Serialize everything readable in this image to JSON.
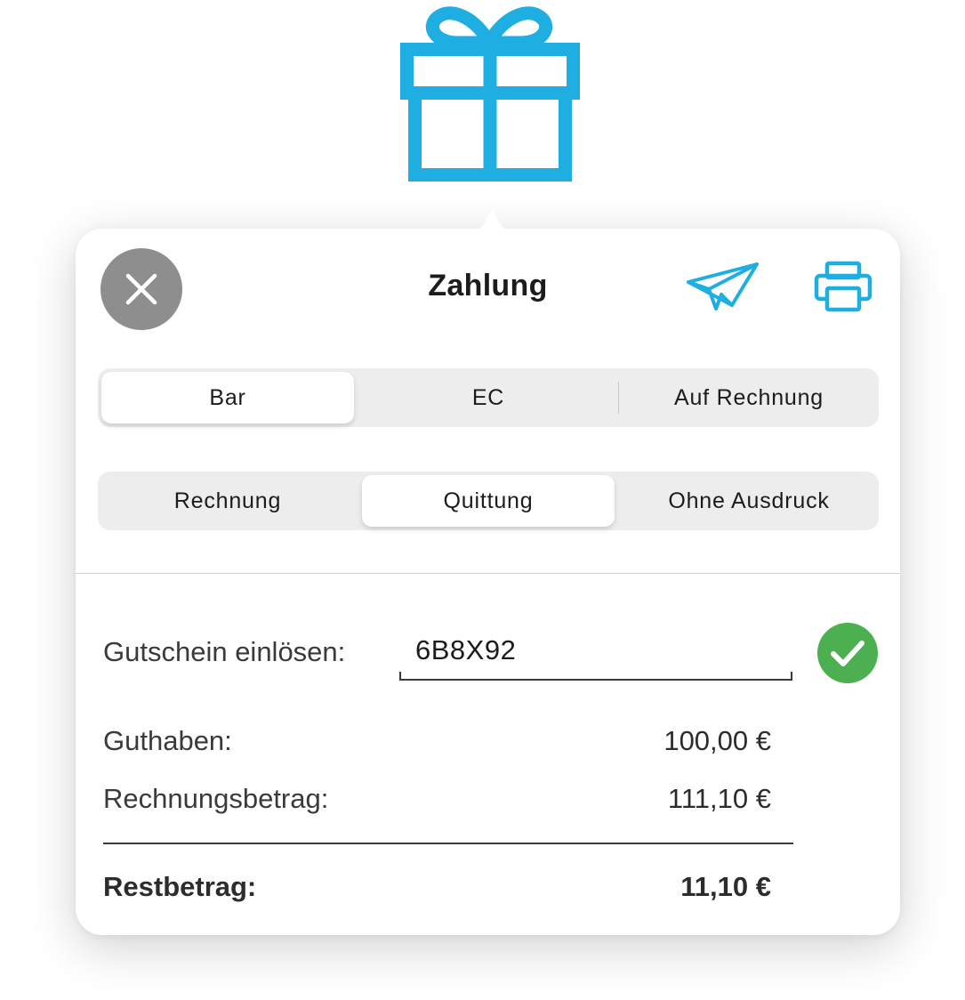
{
  "header": {
    "title": "Zahlung"
  },
  "icons": {
    "gift": "gift-icon",
    "close": "close-icon",
    "send": "paper-plane-icon",
    "print": "printer-icon",
    "confirm": "checkmark-circle-icon"
  },
  "colors": {
    "accent": "#1eaee2",
    "confirm_green": "#4caf50",
    "close_gray": "#8e8e8e"
  },
  "payment_method": {
    "options": [
      "Bar",
      "EC",
      "Auf Rechnung"
    ],
    "selected": "Bar"
  },
  "receipt_type": {
    "options": [
      "Rechnung",
      "Quittung",
      "Ohne Ausdruck"
    ],
    "selected": "Quittung"
  },
  "voucher": {
    "label": "Gutschein einlösen:",
    "value": "6B8X92"
  },
  "summary": {
    "balance_label": "Guthaben:",
    "balance_value": "100,00 €",
    "invoice_label": "Rechnungsbetrag:",
    "invoice_value": "111,10 €",
    "remaining_label": "Restbetrag:",
    "remaining_value": "11,10 €"
  }
}
